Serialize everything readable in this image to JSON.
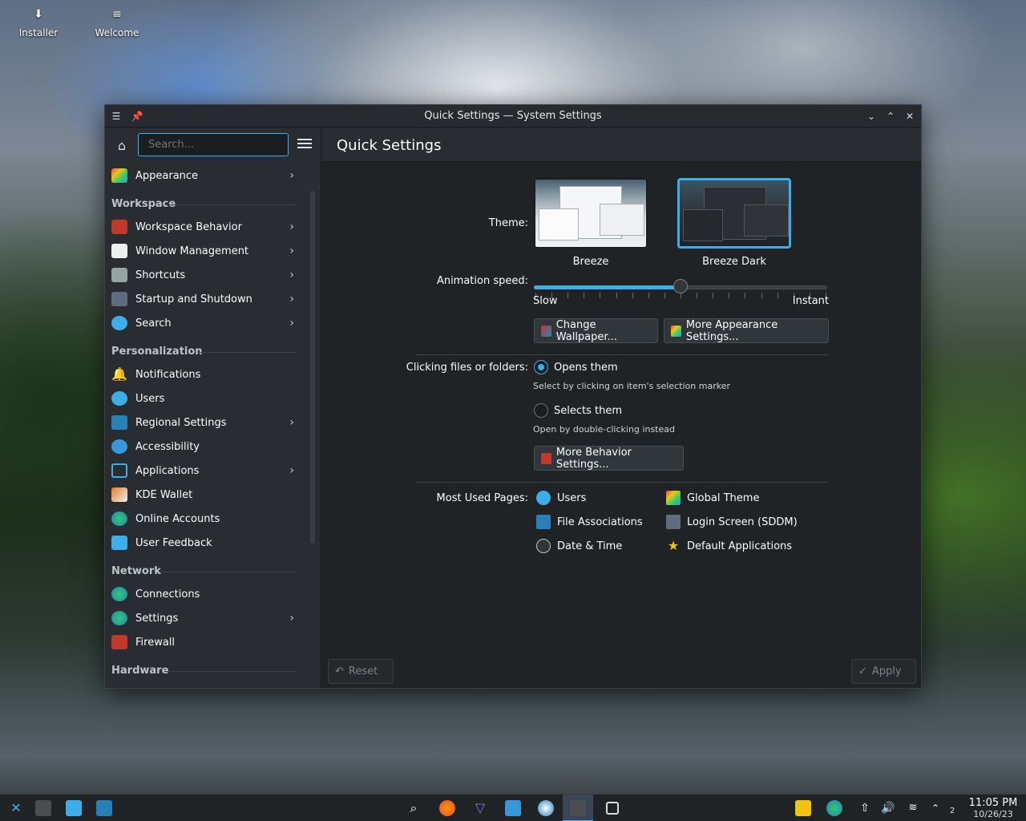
{
  "desktop": {
    "icons": [
      {
        "label": "Installer"
      },
      {
        "label": "Welcome"
      }
    ]
  },
  "window": {
    "title": "Quick Settings — System Settings"
  },
  "sidebar": {
    "search_placeholder": "Search...",
    "top_items": [
      {
        "label": "Appearance",
        "icon": "appearance-icon",
        "chevron": true
      }
    ],
    "sections": [
      {
        "title": "Workspace",
        "items": [
          {
            "label": "Workspace Behavior",
            "icon": "workspace-behavior-icon",
            "chevron": true
          },
          {
            "label": "Window Management",
            "icon": "window-management-icon",
            "chevron": true
          },
          {
            "label": "Shortcuts",
            "icon": "keyboard-icon",
            "chevron": true
          },
          {
            "label": "Startup and Shutdown",
            "icon": "startup-icon",
            "chevron": true
          },
          {
            "label": "Search",
            "icon": "search-icon",
            "chevron": true
          }
        ]
      },
      {
        "title": "Personalization",
        "items": [
          {
            "label": "Notifications",
            "icon": "bell-icon",
            "chevron": false
          },
          {
            "label": "Users",
            "icon": "users-icon",
            "chevron": false
          },
          {
            "label": "Regional Settings",
            "icon": "regional-icon",
            "chevron": true
          },
          {
            "label": "Accessibility",
            "icon": "accessibility-icon",
            "chevron": false
          },
          {
            "label": "Applications",
            "icon": "applications-icon",
            "chevron": true
          },
          {
            "label": "KDE Wallet",
            "icon": "wallet-icon",
            "chevron": false
          },
          {
            "label": "Online Accounts",
            "icon": "online-accounts-icon",
            "chevron": false
          },
          {
            "label": "User Feedback",
            "icon": "feedback-icon",
            "chevron": false
          }
        ]
      },
      {
        "title": "Network",
        "items": [
          {
            "label": "Connections",
            "icon": "globe-icon",
            "chevron": false
          },
          {
            "label": "Settings",
            "icon": "globe-settings-icon",
            "chevron": true
          },
          {
            "label": "Firewall",
            "icon": "firewall-icon",
            "chevron": false
          }
        ]
      },
      {
        "title": "Hardware",
        "items": []
      }
    ]
  },
  "main": {
    "title": "Quick Settings",
    "theme_label": "Theme:",
    "themes": [
      {
        "name": "Breeze",
        "selected": false
      },
      {
        "name": "Breeze Dark",
        "selected": true
      }
    ],
    "animation_label": "Animation speed:",
    "animation_slow": "Slow",
    "animation_instant": "Instant",
    "animation_value": 0.5,
    "change_wallpaper": "Change Wallpaper...",
    "more_appearance": "More Appearance Settings...",
    "clicking_label": "Clicking files or folders:",
    "opens_them": "Opens them",
    "opens_hint": "Select by clicking on item's selection marker",
    "selects_them": "Selects them",
    "selects_hint": "Open by double-clicking instead",
    "more_behavior": "More Behavior Settings...",
    "most_used_label": "Most Used Pages:",
    "most_used": [
      {
        "label": "Users",
        "icon": "users-icon"
      },
      {
        "label": "File Associations",
        "icon": "file-associations-icon"
      },
      {
        "label": "Date & Time",
        "icon": "clock-icon"
      },
      {
        "label": "Global Theme",
        "icon": "global-theme-icon"
      },
      {
        "label": "Login Screen (SDDM)",
        "icon": "login-screen-icon"
      },
      {
        "label": "Default Applications",
        "icon": "star-icon"
      }
    ],
    "reset_label": "Reset",
    "apply_label": "Apply"
  },
  "taskbar": {
    "time": "11:05 PM",
    "date": "10/26/23",
    "workspace_number": "2"
  },
  "colors": {
    "accent": "#3daee9",
    "window_bg": "#202326",
    "sidebar_bg": "#292c30"
  }
}
